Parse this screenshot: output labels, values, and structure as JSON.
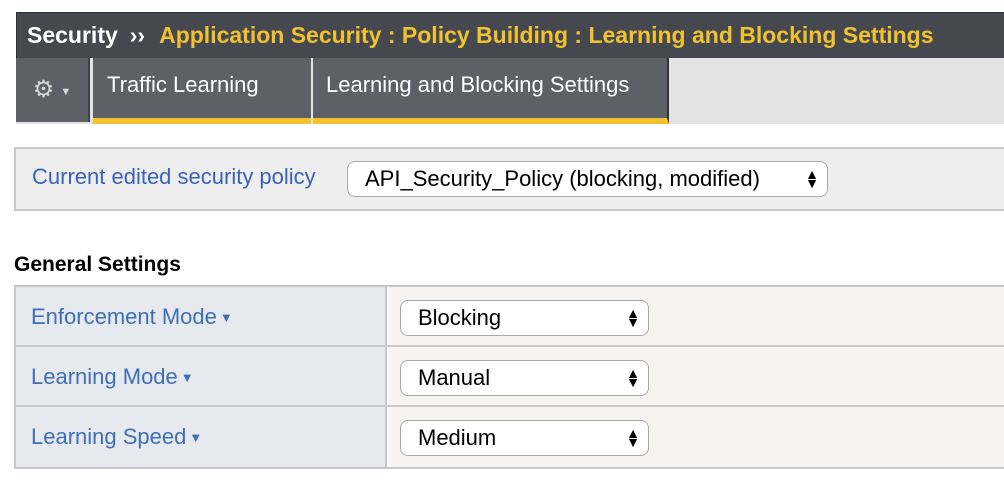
{
  "breadcrumb": {
    "root": "Security",
    "separator": "››",
    "path": "Application Security : Policy Building : Learning and Blocking Settings"
  },
  "tabs": {
    "menu_icon": "gear-icon",
    "items": [
      {
        "label": "Traffic Learning"
      },
      {
        "label": "Learning and Blocking Settings"
      }
    ]
  },
  "policy": {
    "label": "Current edited security policy",
    "selected": "API_Security_Policy (blocking, modified)"
  },
  "general_settings": {
    "title": "General Settings",
    "rows": [
      {
        "label": "Enforcement Mode",
        "value": "Blocking"
      },
      {
        "label": "Learning Mode",
        "value": "Manual"
      },
      {
        "label": "Learning Speed",
        "value": "Medium"
      }
    ]
  },
  "colors": {
    "header_bg": "#45494f",
    "accent_yellow": "#f2c12e",
    "link_blue": "#3f6fb5"
  }
}
